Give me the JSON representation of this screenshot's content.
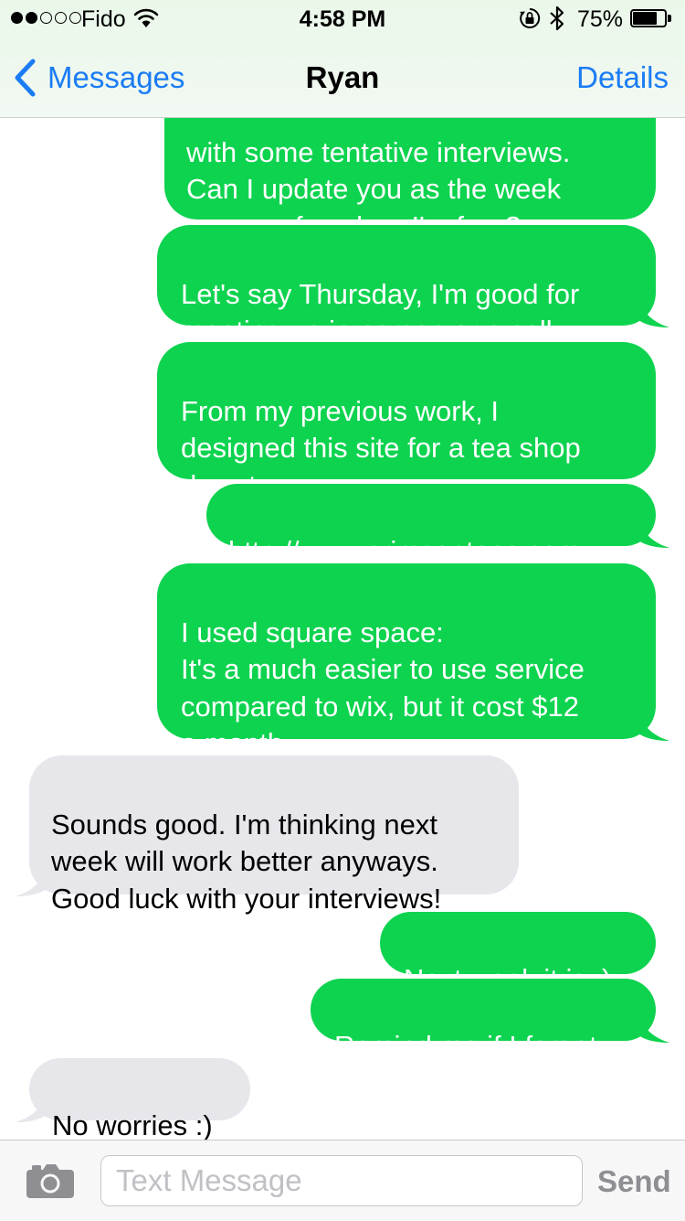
{
  "status_bar": {
    "carrier": "Fido",
    "time": "4:58 PM",
    "battery_percent": "75%",
    "battery_level": 0.75,
    "signal_bars_filled": 2,
    "signal_bars_total": 5
  },
  "nav": {
    "back_label": "Messages",
    "title": "Ryan",
    "details_label": "Details"
  },
  "messages": [
    {
      "from": "me",
      "text": "with some tentative interviews.\nCan I update you as the week\ngoes on for when I'm free?"
    },
    {
      "from": "me",
      "text": "Let's say Thursday, I'm good for\nmeeting up in person or a call"
    },
    {
      "from": "me",
      "text": "From my previous work, I\ndesigned this site for a tea shop\ndowntown:"
    },
    {
      "from": "me",
      "text": "http://www.crimsonteas.com",
      "is_link": true
    },
    {
      "from": "me",
      "text": "I used square space:\nIt's a much easier to use service\ncompared to wix, but it cost $12\na month"
    },
    {
      "from": "them",
      "text": "Sounds good. I'm thinking next\nweek will work better anyways.\nGood luck with your interviews!"
    },
    {
      "from": "me",
      "text": "Next week it is :)"
    },
    {
      "from": "me",
      "text": "Remind me if I forget"
    },
    {
      "from": "them",
      "text": "No worries :)"
    }
  ],
  "input_bar": {
    "placeholder": "Text Message",
    "value": "",
    "send_label": "Send"
  },
  "colors": {
    "sent_bubble": "#0ed34f",
    "received_bubble": "#e6e6eb",
    "accent": "#1a7cf5"
  },
  "icons": {
    "back": "chevron-left-icon",
    "camera": "camera-icon",
    "wifi": "wifi-icon",
    "orientation_lock": "rotation-lock-icon",
    "bluetooth": "bluetooth-icon",
    "battery": "battery-icon"
  }
}
